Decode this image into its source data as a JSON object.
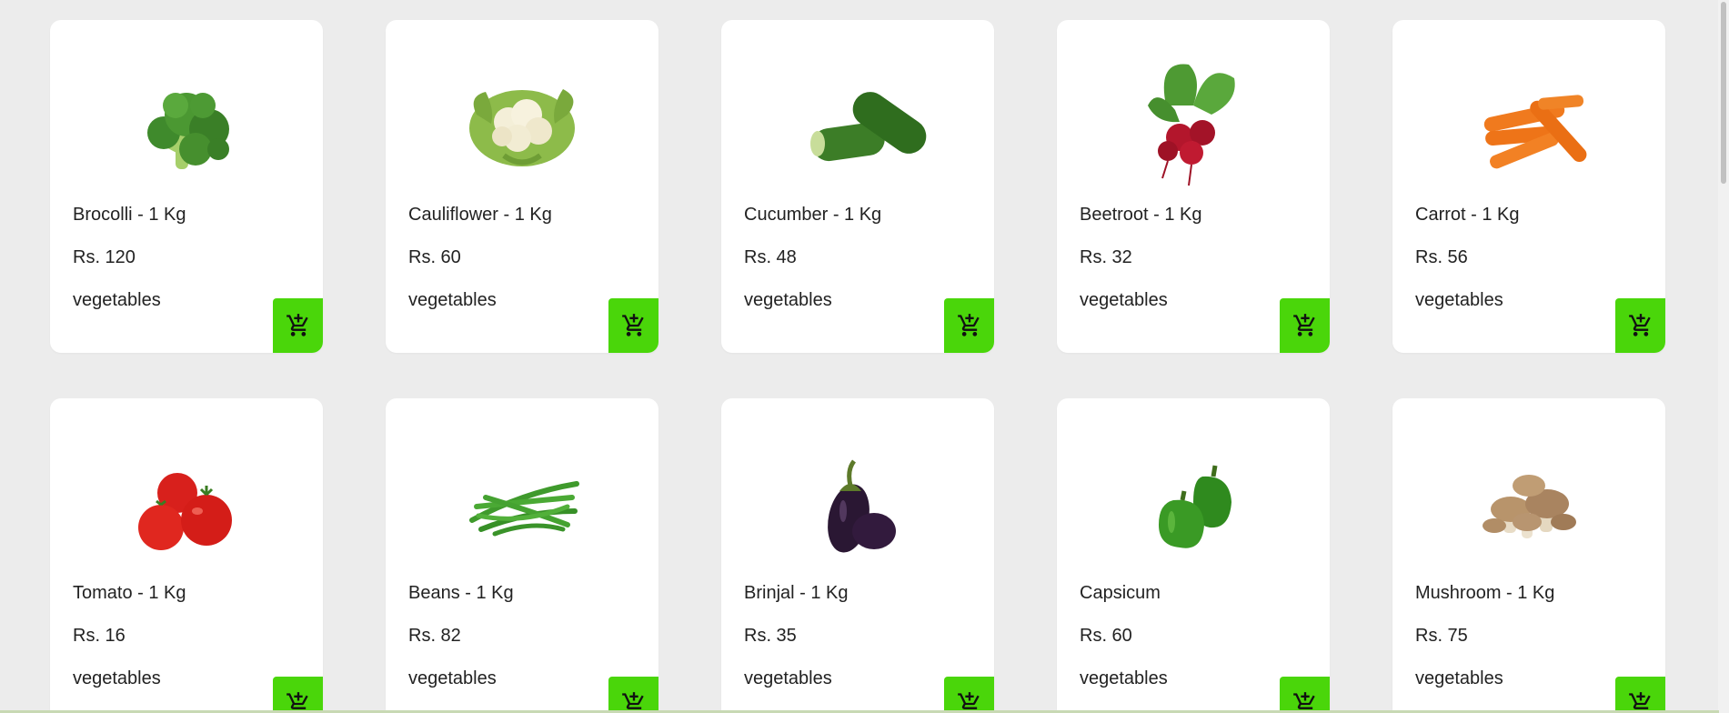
{
  "accent_color": "#4ad60a",
  "cart_icon": "add-shopping-cart-icon",
  "products": [
    {
      "name": "Brocolli - 1 Kg",
      "price": "Rs. 120",
      "category": "vegetables",
      "image": "broccoli"
    },
    {
      "name": "Cauliflower - 1 Kg",
      "price": "Rs. 60",
      "category": "vegetables",
      "image": "cauliflower"
    },
    {
      "name": "Cucumber - 1 Kg",
      "price": "Rs. 48",
      "category": "vegetables",
      "image": "cucumber"
    },
    {
      "name": "Beetroot - 1 Kg",
      "price": "Rs. 32",
      "category": "vegetables",
      "image": "beetroot"
    },
    {
      "name": "Carrot - 1 Kg",
      "price": "Rs. 56",
      "category": "vegetables",
      "image": "carrot"
    },
    {
      "name": "Tomato - 1 Kg",
      "price": "Rs. 16",
      "category": "vegetables",
      "image": "tomato"
    },
    {
      "name": "Beans - 1 Kg",
      "price": "Rs. 82",
      "category": "vegetables",
      "image": "beans"
    },
    {
      "name": "Brinjal - 1 Kg",
      "price": "Rs. 35",
      "category": "vegetables",
      "image": "brinjal"
    },
    {
      "name": "Capsicum",
      "price": "Rs. 60",
      "category": "vegetables",
      "image": "capsicum"
    },
    {
      "name": "Mushroom - 1 Kg",
      "price": "Rs. 75",
      "category": "vegetables",
      "image": "mushroom"
    }
  ]
}
